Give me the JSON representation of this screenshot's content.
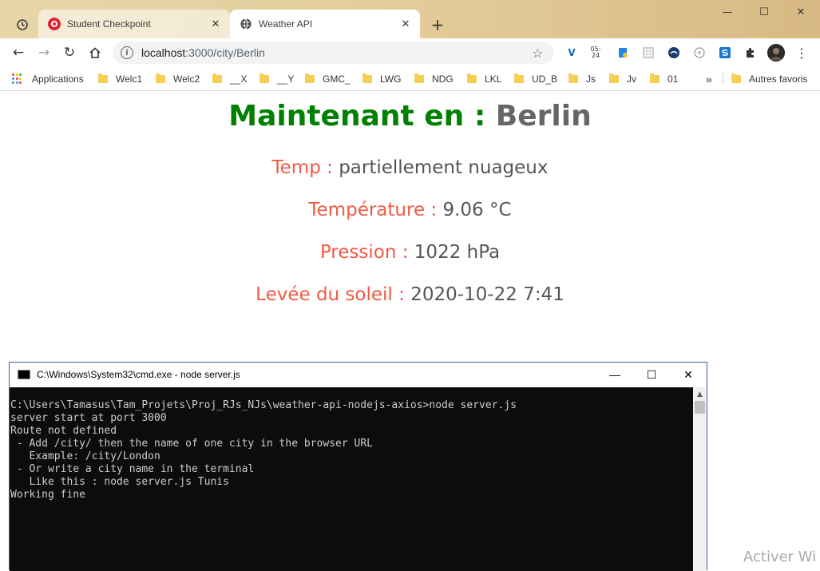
{
  "tabs": [
    {
      "label": "Student Checkpoint",
      "favicon": "checkpoint-icon",
      "color": "#e2212d"
    },
    {
      "label": "Weather API",
      "favicon": "globe-icon"
    }
  ],
  "address": {
    "host": "localhost",
    "path": ":3000/city/Berlin"
  },
  "extensions": {
    "clock_text_top": "05:",
    "clock_text_bottom": "24"
  },
  "bookmarks": {
    "apps": "Applications",
    "items": [
      "Welc1",
      "Welc2",
      "__X",
      "__Y",
      "GMC_",
      "LWG",
      "NDG",
      "LKL",
      "UD_B",
      "Js",
      "Jv",
      "01"
    ],
    "overflow": "»",
    "other": "Autres favoris"
  },
  "weather": {
    "headline_label": "Maintenant en :",
    "city": "Berlin",
    "rows": [
      {
        "label": "Temp :",
        "value": "partiellement nuageux"
      },
      {
        "label": "Température :",
        "value": "9.06 °C"
      },
      {
        "label": "Pression :",
        "value": "1022 hPa"
      },
      {
        "label": "Levée du soleil :",
        "value": "2020-10-22 7:41"
      }
    ]
  },
  "cmd": {
    "title": "C:\\Windows\\System32\\cmd.exe - node  server.js",
    "lines": [
      "C:\\Users\\Tamasus\\Tam_Projets\\Proj_RJs_NJs\\weather-api-nodejs-axios>node server.js",
      "server start at port 3000",
      "",
      "Route not defined",
      " - Add /city/ then the name of one city in the browser URL",
      "   Example: /city/London",
      " - Or write a city name in the terminal",
      "   Like this : node server.js Tunis",
      "Working fine"
    ]
  },
  "watermark": "Activer Wi",
  "colors": {
    "label": "#f05a44",
    "headline_label": "#008000",
    "value": "#555555"
  }
}
